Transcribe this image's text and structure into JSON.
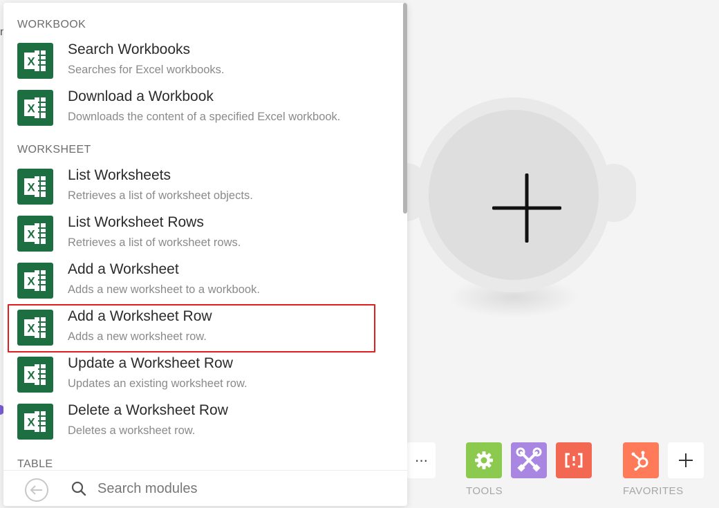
{
  "canvas": {
    "edge_fragment": "n"
  },
  "panel": {
    "sections": [
      {
        "header": "WORKBOOK",
        "items": [
          {
            "title": "Search Workbooks",
            "description": "Searches for Excel workbooks."
          },
          {
            "title": "Download a Workbook",
            "description": "Downloads the content of a specified Excel workbook."
          }
        ]
      },
      {
        "header": "WORKSHEET",
        "items": [
          {
            "title": "List Worksheets",
            "description": "Retrieves a list of worksheet objects."
          },
          {
            "title": "List Worksheet Rows",
            "description": "Retrieves a list of worksheet rows."
          },
          {
            "title": "Add a Worksheet",
            "description": "Adds a new worksheet to a workbook."
          },
          {
            "title": "Add a Worksheet Row",
            "description": "Adds a new worksheet row.",
            "highlighted": true
          },
          {
            "title": "Update a Worksheet Row",
            "description": "Updates an existing worksheet row."
          },
          {
            "title": "Delete a Worksheet Row",
            "description": "Deletes a worksheet row."
          }
        ]
      },
      {
        "header": "TABLE",
        "items": []
      }
    ],
    "search": {
      "placeholder": "Search modules",
      "value": ""
    },
    "item_icon": "excel-icon"
  },
  "toolbar": {
    "more_label": "···",
    "groups": [
      {
        "label": "TOOLS",
        "buttons": [
          {
            "icon": "gear-icon",
            "color": "#8cc94f"
          },
          {
            "icon": "tools-icon",
            "color": "#a986e2"
          },
          {
            "icon": "json-brackets-icon",
            "color": "#f26852"
          }
        ]
      },
      {
        "label": "FAVORITES",
        "buttons": [
          {
            "icon": "hubspot-icon",
            "color": "#ff7a59"
          },
          {
            "icon": "plus-icon",
            "color": "#ffffff"
          }
        ]
      }
    ]
  },
  "colors": {
    "excel_green": "#1d6f42",
    "highlight_red": "#e01e1e"
  }
}
